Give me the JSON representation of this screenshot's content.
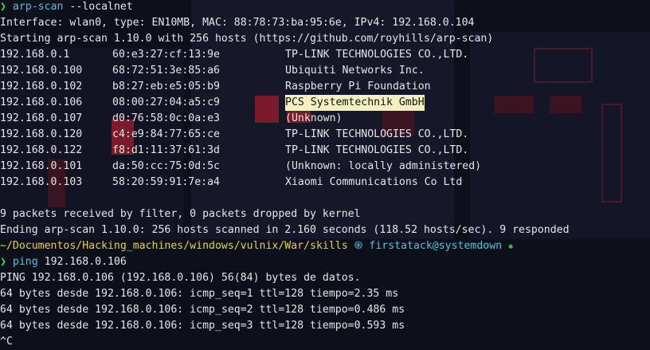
{
  "prompt_symbol": "❯",
  "commands": {
    "arp_scan": {
      "cmd": "arp-scan",
      "args": "--localnet"
    },
    "ping": {
      "cmd": "ping",
      "args": "192.168.0.106"
    }
  },
  "arp_output": {
    "interface_line": "Interface: wlan0, type: EN10MB, MAC: 88:78:73:ba:95:6e, IPv4: 192.168.0.104",
    "start_line": "Starting arp-scan 1.10.0 with 256 hosts (https://github.com/royhills/arp-scan)",
    "rows": [
      {
        "ip": "192.168.0.1",
        "mac": "60:e3:27:cf:13:9e",
        "vendor": "TP-LINK TECHNOLOGIES CO.,LTD."
      },
      {
        "ip": "192.168.0.100",
        "mac": "68:72:51:3e:85:a6",
        "vendor": "Ubiquiti Networks Inc."
      },
      {
        "ip": "192.168.0.102",
        "mac": "b8:27:eb:e5:05:b9",
        "vendor": "Raspberry Pi Foundation"
      },
      {
        "ip": "192.168.0.106",
        "mac": "08:00:27:04:a5:c9",
        "vendor": "PCS Systemtechnik GmbH",
        "highlighted": true
      },
      {
        "ip": "192.168.0.107",
        "mac": "d0:76:58:0c:0a:e3",
        "vendor": "(Unknown)"
      },
      {
        "ip": "192.168.0.120",
        "mac": "c4:e9:84:77:65:ce",
        "vendor": "TP-LINK TECHNOLOGIES CO.,LTD."
      },
      {
        "ip": "192.168.0.122",
        "mac": "f8:d1:11:37:61:3d",
        "vendor": "TP-LINK TECHNOLOGIES CO.,LTD."
      },
      {
        "ip": "192.168.0.101",
        "mac": "da:50:cc:75:0d:5c",
        "vendor": "(Unknown: locally administered)"
      },
      {
        "ip": "192.168.0.103",
        "mac": "58:20:59:91:7e:a4",
        "vendor": "Xiaomi Communications Co Ltd"
      }
    ],
    "received_line": "9 packets received by filter, 0 packets dropped by kernel",
    "ending_line": "Ending arp-scan 1.10.0: 256 hosts scanned in 2.160 seconds (118.52 hosts/sec). 9 responded"
  },
  "prompt_status": {
    "path": "~/Documentos/Hacking_machines/windows/vulnix/War/skills",
    "user_host": "firstatack@systemdown",
    "status_icon": "spiral-icon",
    "end_icon": "star-icon"
  },
  "ping_output": {
    "header": "PING 192.168.0.106 (192.168.0.106) 56(84) bytes de datos.",
    "replies": [
      "64 bytes desde 192.168.0.106: icmp_seq=1 ttl=128 tiempo=2.35 ms",
      "64 bytes desde 192.168.0.106: icmp_seq=2 ttl=128 tiempo=0.486 ms",
      "64 bytes desde 192.168.0.106: icmp_seq=3 ttl=128 tiempo=0.593 ms"
    ],
    "interrupt": "^C"
  },
  "colors": {
    "background": "#0d0f1a",
    "prompt_green": "#3ddc4b",
    "command_cyan": "#4fc4d6",
    "path_yellow": "#e0d443",
    "highlight": "#f5f0c2"
  }
}
